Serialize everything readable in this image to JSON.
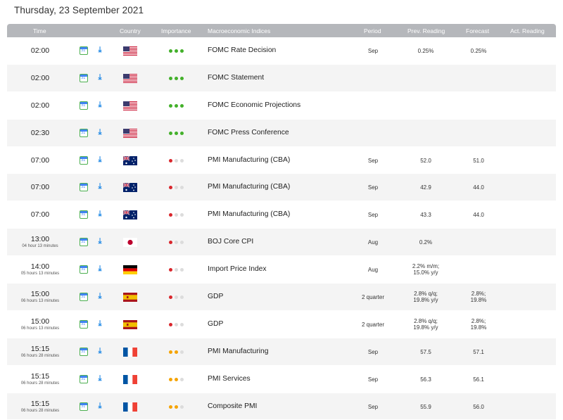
{
  "page_title": "Thursday, 23 September 2021",
  "colors": {
    "header_bg": "#b5b7bb",
    "dot_green": "#43b02a",
    "dot_red": "#d9262c",
    "dot_orange": "#f5a300",
    "dot_empty": "#dcdcdc"
  },
  "columns": {
    "time": "Time",
    "country": "Country",
    "importance": "Importance",
    "indicator": "Macroeconomic Indices",
    "period": "Period",
    "prev": "Prev. Reading",
    "forecast": "Forecast",
    "actual": "Act. Reading"
  },
  "rows": [
    {
      "time": "02:00",
      "sub": "",
      "flag": "us",
      "importance": "high",
      "indicator": "FOMC Rate Decision",
      "period": "Sep",
      "prev": "0.25%",
      "forecast": "0.25%",
      "actual": ""
    },
    {
      "time": "02:00",
      "sub": "",
      "flag": "us",
      "importance": "high",
      "indicator": "FOMC Statement",
      "period": "",
      "prev": "",
      "forecast": "",
      "actual": ""
    },
    {
      "time": "02:00",
      "sub": "",
      "flag": "us",
      "importance": "high",
      "indicator": "FOMC Economic Projections",
      "period": "",
      "prev": "",
      "forecast": "",
      "actual": ""
    },
    {
      "time": "02:30",
      "sub": "",
      "flag": "us",
      "importance": "high",
      "indicator": "FOMC Press Conference",
      "period": "",
      "prev": "",
      "forecast": "",
      "actual": ""
    },
    {
      "time": "07:00",
      "sub": "",
      "flag": "au",
      "importance": "low",
      "indicator": "PMI Manufacturing (CBA)",
      "period": "Sep",
      "prev": "52.0",
      "forecast": "51.0",
      "actual": ""
    },
    {
      "time": "07:00",
      "sub": "",
      "flag": "au",
      "importance": "low",
      "indicator": "PMI Manufacturing (CBA)",
      "period": "Sep",
      "prev": "42.9",
      "forecast": "44.0",
      "actual": ""
    },
    {
      "time": "07:00",
      "sub": "",
      "flag": "au",
      "importance": "low",
      "indicator": "PMI Manufacturing (CBA)",
      "period": "Sep",
      "prev": "43.3",
      "forecast": "44.0",
      "actual": ""
    },
    {
      "time": "13:00",
      "sub": "04 hour 13 minutes",
      "flag": "jp",
      "importance": "low",
      "indicator": "BOJ Core CPI",
      "period": "Aug",
      "prev": "0.2%",
      "forecast": "",
      "actual": ""
    },
    {
      "time": "14:00",
      "sub": "05 hours 13 minutes",
      "flag": "de",
      "importance": "low",
      "indicator": "Import Price Index",
      "period": "Aug",
      "prev": "2.2% m/m;\n15.0% y/y",
      "forecast": "",
      "actual": ""
    },
    {
      "time": "15:00",
      "sub": "06 hours 13 minutes",
      "flag": "es",
      "importance": "low",
      "indicator": "GDP",
      "period": "2 quarter",
      "prev": "2.8% q/q;\n19.8% y/y",
      "forecast": "2.8%;\n19.8%",
      "actual": ""
    },
    {
      "time": "15:00",
      "sub": "06 hours 13 minutes",
      "flag": "es",
      "importance": "low",
      "indicator": "GDP",
      "period": "2 quarter",
      "prev": "2.8% q/q;\n19.8% y/y",
      "forecast": "2.8%;\n19.8%",
      "actual": ""
    },
    {
      "time": "15:15",
      "sub": "06 hours 28 minutes",
      "flag": "fr",
      "importance": "medium",
      "indicator": "PMI Manufacturing",
      "period": "Sep",
      "prev": "57.5",
      "forecast": "57.1",
      "actual": ""
    },
    {
      "time": "15:15",
      "sub": "06 hours 28 minutes",
      "flag": "fr",
      "importance": "medium",
      "indicator": "PMI Services",
      "period": "Sep",
      "prev": "56.3",
      "forecast": "56.1",
      "actual": ""
    },
    {
      "time": "15:15",
      "sub": "06 hours 28 minutes",
      "flag": "fr",
      "importance": "medium",
      "indicator": "Composite PMI",
      "period": "Sep",
      "prev": "55.9",
      "forecast": "56.0",
      "actual": ""
    }
  ]
}
